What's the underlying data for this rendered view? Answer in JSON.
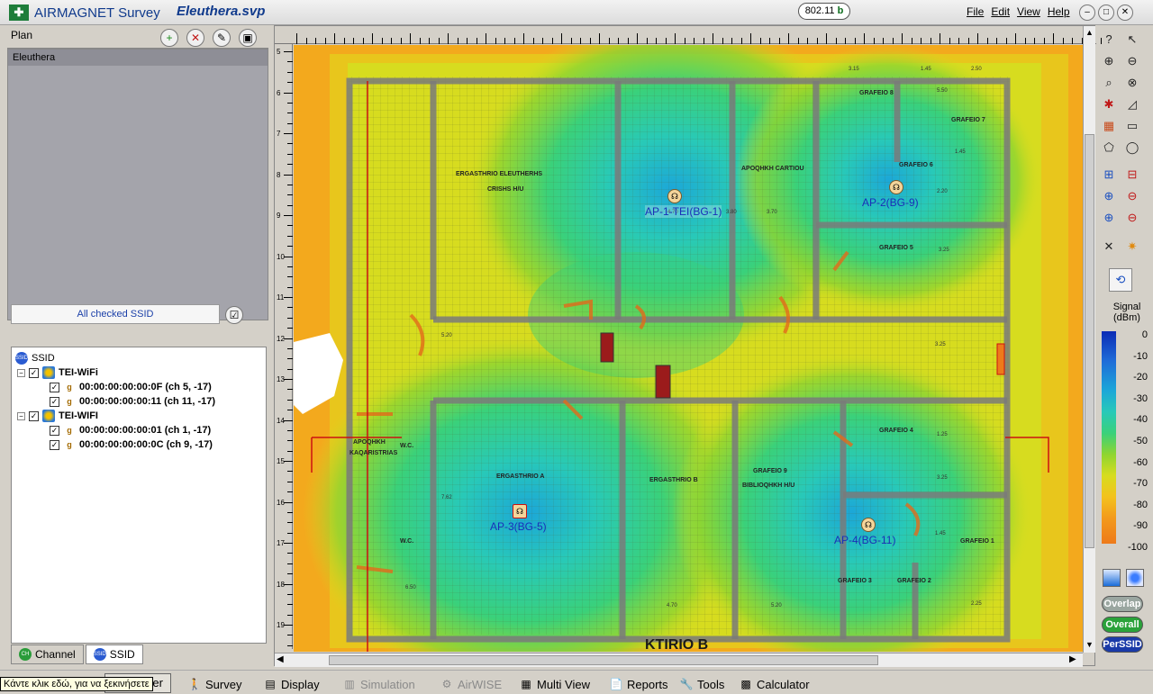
{
  "window": {
    "app_title": "AIRMAGNET Survey",
    "document_title": "Eleuthera.svp",
    "standard_badge": "802.11",
    "standard_badge_suffix": "b",
    "menu": [
      "File",
      "Edit",
      "View",
      "Help"
    ]
  },
  "plan_panel": {
    "label": "Plan",
    "items": [
      "Eleuthera"
    ]
  },
  "ssid_filter": {
    "label": "All checked SSID"
  },
  "tree": {
    "root": "SSID",
    "groups": [
      {
        "name": "TEI-WiFi",
        "aps": [
          "00:00:00:00:00:0F (ch 5, -17)",
          "00:00:00:00:00:11 (ch 11, -17)"
        ]
      },
      {
        "name": "TEI-WIFI",
        "aps": [
          "00:00:00:00:00:01 (ch 1, -17)",
          "00:00:00:00:00:0C (ch 9, -17)"
        ]
      }
    ]
  },
  "bottom_tabs": [
    "Channel",
    "SSID"
  ],
  "map": {
    "ruler_left_numbers": [
      "5",
      "6",
      "7",
      "8",
      "9",
      "10",
      "11",
      "12",
      "13",
      "14",
      "15",
      "16",
      "17",
      "18",
      "19"
    ],
    "access_points": [
      "AP-1-TEI(BG-1)",
      "AP-2(BG-9)",
      "AP-3(BG-5)",
      "AP-4(BG-11)"
    ],
    "rooms": [
      "ERGASTHRIO ELEUTHERHS",
      "CRISHS H/U",
      "APOQHKH CARTIOU",
      "GRAFEIO 6",
      "GRAFEIO 8",
      "GRAFEIO 7",
      "GRAFEIO 5",
      "GRAFEIO 4",
      "GRAFEIO 3",
      "GRAFEIO 2",
      "GRAFEIO 1",
      "ERGASTHRIO A",
      "ERGASTHRIO B",
      "GRAFEIO 9",
      "BIBLIOQHKH H/U",
      "W.C.",
      "W.C.",
      "APOQHKH",
      "KAQARISTRIAS"
    ],
    "dimensions": [
      "3.15",
      "1.45",
      "2.50",
      "3.80",
      "4.70",
      "3.70",
      "5.50",
      "1.45",
      "2.20",
      "3.25",
      "5.20",
      "3.25",
      "1.25",
      "3.25",
      "1.45",
      "7.62",
      "6.50",
      "4.70",
      "5.20",
      "2.25"
    ],
    "bottom_label": "KTIRIO B"
  },
  "legend": {
    "title": "Signal",
    "unit": "(dBm)",
    "ticks": [
      "0",
      "-10",
      "-20",
      "-30",
      "-40",
      "-50",
      "-60",
      "-70",
      "-80",
      "-90",
      "-100"
    ],
    "modes": [
      "Overlap",
      "Overall",
      "PerSSID"
    ]
  },
  "colors": {
    "strong": "#1f6cd8",
    "good": "#28c9b8",
    "medium": "#8fd530",
    "weak": "#f3c21d",
    "poor": "#ee7a1a"
  },
  "statusbar": {
    "tooltip": "Κάντε κλικ εδώ, για να ξεκινήσετε",
    "partial_button": "ner",
    "nav": [
      {
        "label": "Survey",
        "icon": "walker-icon",
        "enabled": true
      },
      {
        "label": "Display",
        "icon": "display-icon",
        "enabled": true
      },
      {
        "label": "Simulation",
        "icon": "simulation-icon",
        "enabled": false
      },
      {
        "label": "AirWISE",
        "icon": "airwise-icon",
        "enabled": false
      },
      {
        "label": "Multi View",
        "icon": "multiview-icon",
        "enabled": true
      },
      {
        "label": "Reports",
        "icon": "reports-icon",
        "enabled": true
      },
      {
        "label": "Tools",
        "icon": "tools-icon",
        "enabled": true
      },
      {
        "label": "Calculator",
        "icon": "calculator-icon",
        "enabled": true
      }
    ]
  }
}
